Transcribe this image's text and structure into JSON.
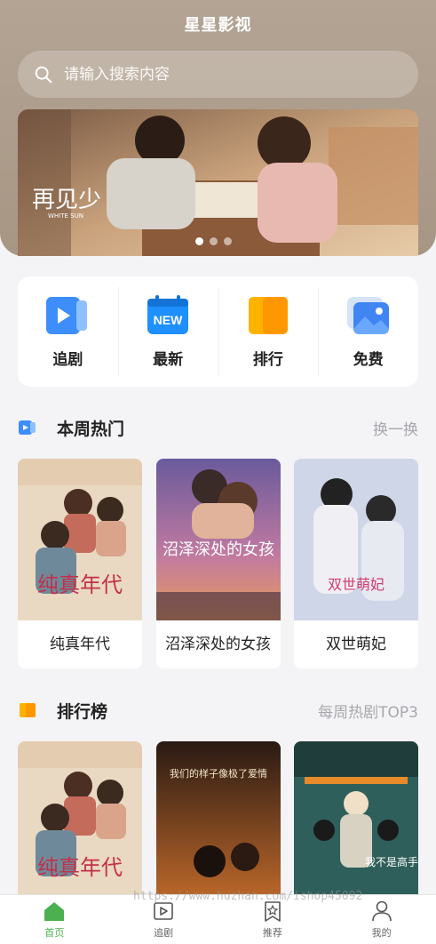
{
  "app": {
    "title": "星星影视"
  },
  "search": {
    "placeholder": "请输入搜索内容"
  },
  "banner": {
    "caption": "再见少",
    "caption_en": "WHITE SUN",
    "dots": 3,
    "active_dot": 0
  },
  "quick_nav": [
    {
      "label": "追剧",
      "icon": "play-video-icon"
    },
    {
      "label": "最新",
      "icon": "new-calendar-icon",
      "badge": "NEW"
    },
    {
      "label": "排行",
      "icon": "ranking-icon"
    },
    {
      "label": "免费",
      "icon": "image-icon"
    }
  ],
  "weekly_hot": {
    "title": "本周热门",
    "more": "换一换",
    "items": [
      {
        "name": "纯真年代",
        "poster_text": "纯真年代"
      },
      {
        "name": "沼泽深处的女孩",
        "poster_text": "沼泽深处的女孩"
      },
      {
        "name": "双世萌妃",
        "poster_text": "双世萌妃"
      }
    ]
  },
  "ranking": {
    "title": "排行榜",
    "more": "每周热剧TOP3",
    "items": [
      {
        "poster_text": "纯真年代"
      },
      {
        "poster_text": "我们的样子像极了爱情"
      },
      {
        "poster_text": "我不是高手"
      }
    ]
  },
  "tabbar": [
    {
      "label": "首页",
      "icon": "home-icon",
      "active": true
    },
    {
      "label": "追剧",
      "icon": "play-icon",
      "active": false
    },
    {
      "label": "推荐",
      "icon": "star-bookmark-icon",
      "active": false
    },
    {
      "label": "我的",
      "icon": "user-icon",
      "active": false
    }
  ],
  "watermark": "https://www.huzhan.com/ishop45092",
  "colors": {
    "header": "#ad9c8a",
    "accent": "#4caf50",
    "muted": "#a7a7ad"
  }
}
